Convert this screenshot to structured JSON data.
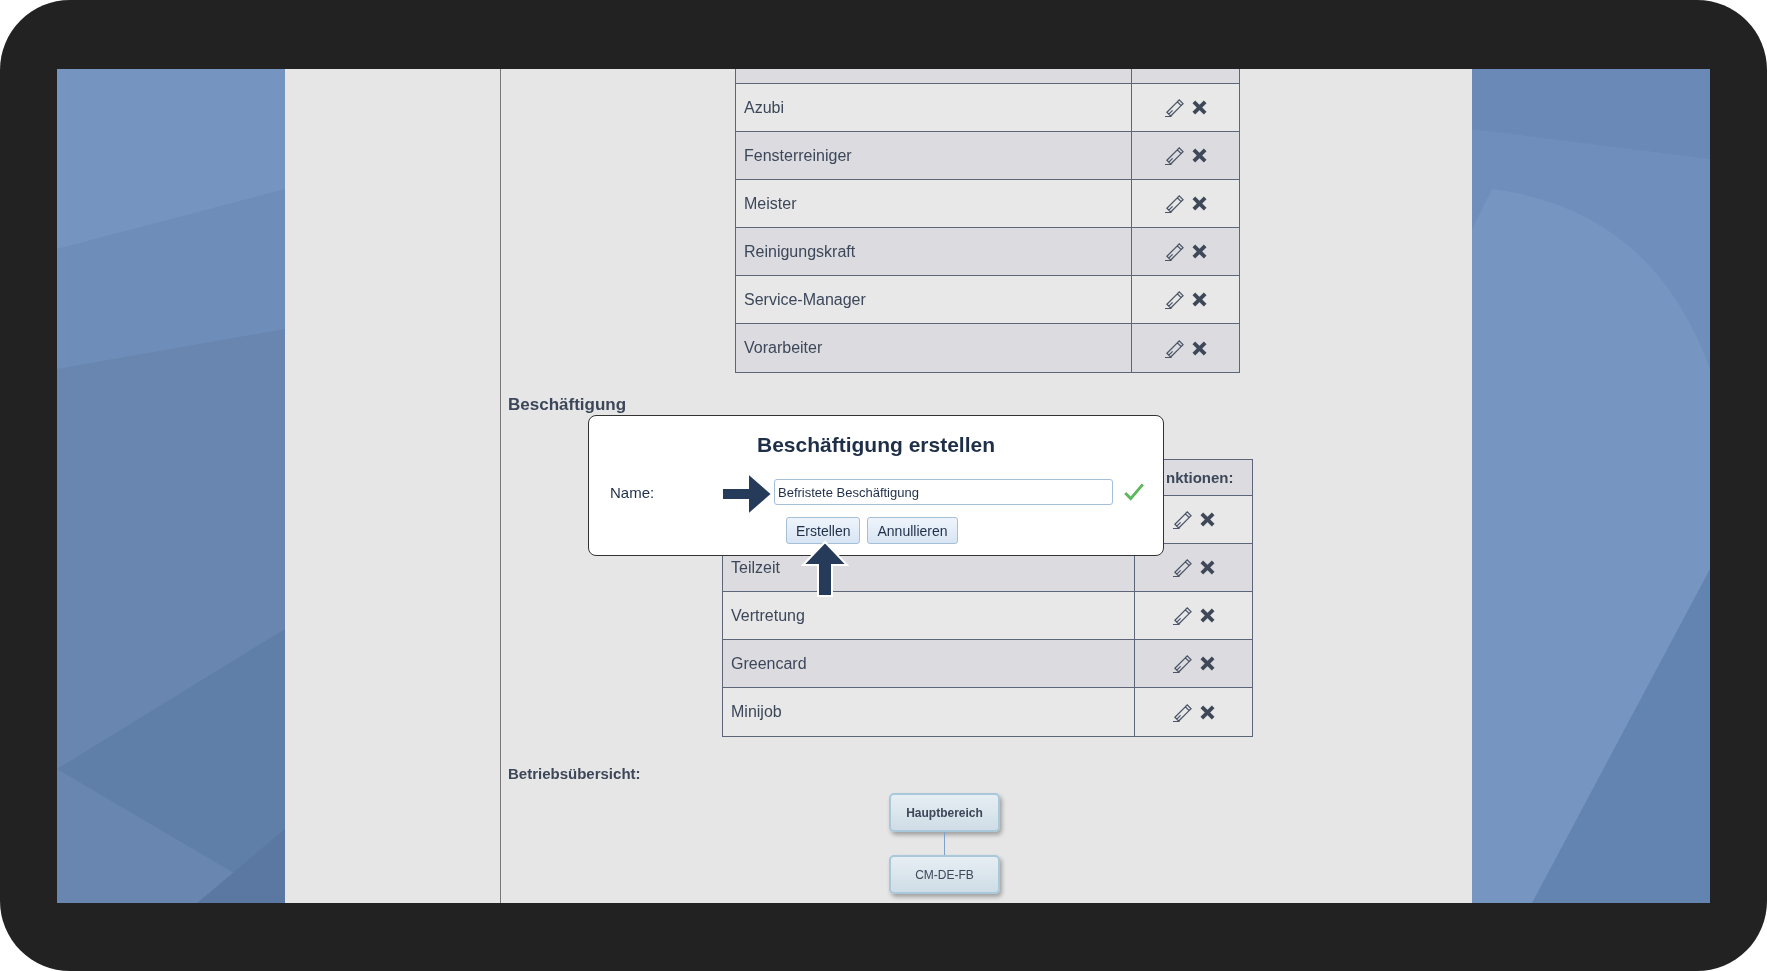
{
  "table_top": {
    "rows": [
      {
        "name": "Azubi"
      },
      {
        "name": "Fensterreiniger"
      },
      {
        "name": "Meister"
      },
      {
        "name": "Reinigungskraft"
      },
      {
        "name": "Service-Manager"
      },
      {
        "name": "Vorarbeiter"
      }
    ]
  },
  "section_heading": "Beschäftigung",
  "table_bottom": {
    "header_right": "nktionen:",
    "rows": [
      {
        "kind": "covered"
      },
      {
        "kind": "named",
        "name": "Teilzeit"
      },
      {
        "kind": "named",
        "name": "Vertretung"
      },
      {
        "kind": "named",
        "name": "Greencard"
      },
      {
        "kind": "named",
        "name": "Minijob"
      }
    ]
  },
  "dialog": {
    "title": "Beschäftigung erstellen",
    "field_label": "Name:",
    "value": "Befristete Beschäftigung",
    "valid": true,
    "buttons": [
      "Erstellen",
      "Annullieren"
    ]
  },
  "overview": {
    "heading": "Betriebsübersicht:",
    "nodes": [
      {
        "label": "Hauptbereich",
        "bold": true
      },
      {
        "label": "CM-DE-FB",
        "bold": false
      }
    ]
  }
}
